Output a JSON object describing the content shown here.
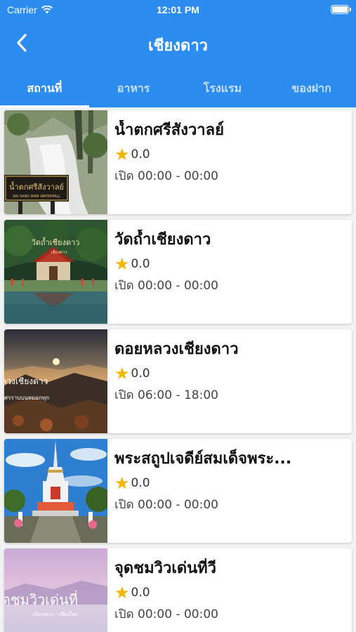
{
  "status_bar": {
    "carrier": "Carrier",
    "time": "12:01 PM"
  },
  "header": {
    "title": "เชียงดาว"
  },
  "tabs": [
    {
      "label": "สถานที่",
      "active": true
    },
    {
      "label": "อาหาร",
      "active": false
    },
    {
      "label": "โรงแรม",
      "active": false
    },
    {
      "label": "ของฝาก",
      "active": false
    }
  ],
  "places": [
    {
      "name": "น้ำตกศรีสังวาลย์",
      "rating": "0.0",
      "hours": "เปิด 00:00 - 00:00",
      "image_sign": "น้ำตกศรีสังวาลย์",
      "image_sub": "SRI SANG WAN WATERFALL"
    },
    {
      "name": "วัดถ้ำเชียงดาว",
      "rating": "0.0",
      "hours": "เปิด 00:00 - 00:00",
      "image_sign": "วัดถ้ำเชียงดาว",
      "image_sub": "เชียงดาว"
    },
    {
      "name": "ดอยหลวงเชียงดาว",
      "rating": "0.0",
      "hours": "เปิด 06:00 - 18:00",
      "image_sign": "ลวงเชียงดาว",
      "image_sub": "ศรราบบนหมอกทุก"
    },
    {
      "name": "พระสถูปเจดีย์สมเด็จพระ...",
      "rating": "0.0",
      "hours": "เปิด 00:00 - 00:00",
      "image_sign": "",
      "image_sub": ""
    },
    {
      "name": "จุดชมวิวเด่นที่วี",
      "rating": "0.0",
      "hours": "เปิด 00:00 - 00:00",
      "image_sign": "ดชมวิวเด่นที่",
      "image_sub": "เมืองหลวง - เชียงใหม่"
    }
  ],
  "colors": {
    "primary": "#2c8cf0",
    "star": "#f4b400"
  }
}
